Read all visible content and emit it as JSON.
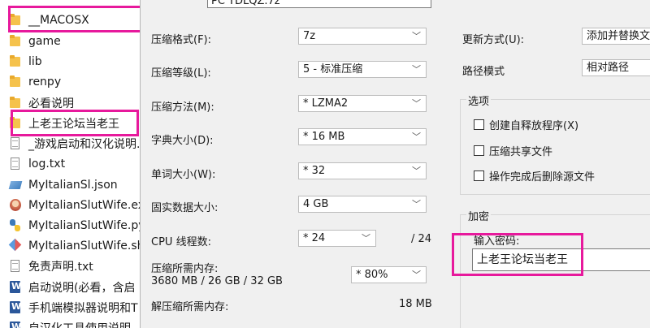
{
  "explorer": {
    "items": [
      {
        "name": "__MACOSX",
        "icon": "folder-icon"
      },
      {
        "name": "game",
        "icon": "folder-icon"
      },
      {
        "name": "lib",
        "icon": "folder-icon"
      },
      {
        "name": "renpy",
        "icon": "folder-icon"
      },
      {
        "name": "必看说明",
        "icon": "folder-icon"
      },
      {
        "name": "上老王论坛当老王",
        "icon": "folder-icon"
      },
      {
        "name": "_游戏启动和汉化说明.",
        "icon": "text-file-icon"
      },
      {
        "name": "log.txt",
        "icon": "text-file-icon"
      },
      {
        "name": "MyItalianSl.json",
        "icon": "json-file-icon"
      },
      {
        "name": "MyItalianSlutWife.ex",
        "icon": "game-exe-icon"
      },
      {
        "name": "MyItalianSlutWife.py",
        "icon": "python-file-icon"
      },
      {
        "name": "MyItalianSlutWife.sh",
        "icon": "shell-script-icon"
      },
      {
        "name": "免责声明.txt",
        "icon": "text-file-icon"
      },
      {
        "name": "启动说明(必看，含启",
        "icon": "word-doc-icon"
      },
      {
        "name": "手机端模拟器说明和T",
        "icon": "word-doc-icon"
      },
      {
        "name": "自汉化工具使用说明",
        "icon": "word-doc-icon"
      }
    ]
  },
  "dialog": {
    "archive_name": "PC YDLQZ.7z",
    "format": {
      "label": "压缩格式(F):",
      "value": "7z"
    },
    "level": {
      "label": "压缩等级(L):",
      "value": "5 - 标准压缩"
    },
    "method": {
      "label": "压缩方法(M):",
      "value": "* LZMA2"
    },
    "dict": {
      "label": "字典大小(D):",
      "value": "* 16 MB"
    },
    "word": {
      "label": "单词大小(W):",
      "value": "* 32"
    },
    "solid": {
      "label": "固实数据大小:",
      "value": "4 GB"
    },
    "threads": {
      "label": "CPU 线程数:",
      "value": "* 24",
      "max": "/ 24"
    },
    "mem_compress": {
      "label": "压缩所需内存:",
      "detail": "3680 MB / 26 GB / 32 GB",
      "value": "* 80%"
    },
    "mem_decompress": {
      "label": "解压缩所需内存:",
      "value": "18 MB"
    },
    "update_mode": {
      "label": "更新方式(U):",
      "value": "添加并替换文件"
    },
    "path_mode": {
      "label": "路径模式",
      "value": "相对路径"
    },
    "options": {
      "title": "选项",
      "sfx": "创建自释放程序(X)",
      "shared": "压缩共享文件",
      "delete": "操作完成后删除源文件"
    },
    "encryption": {
      "title": "加密",
      "password_label": "输入密码:",
      "password_value": "上老王论坛当老王"
    }
  },
  "colors": {
    "highlight": "#e7199c",
    "folder": "#f5c24c",
    "dialog_bg": "#f0f0f0"
  }
}
